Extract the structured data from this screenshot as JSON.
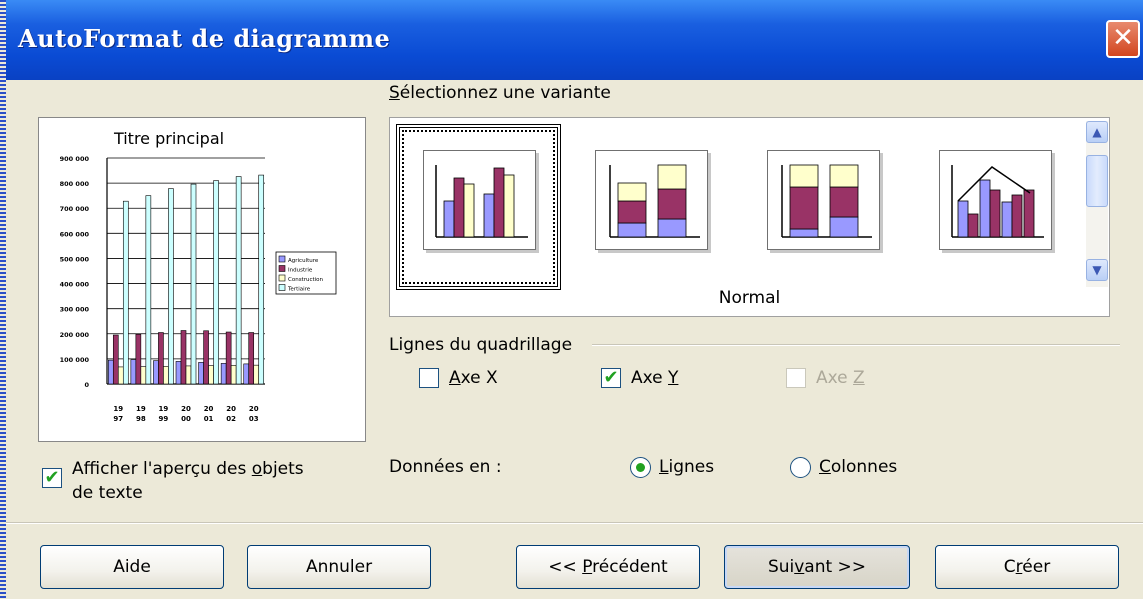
{
  "dialog": {
    "title": "AutoFormat de diagramme",
    "close_symbol": "✕"
  },
  "preview": {
    "chart_data": {
      "type": "bar",
      "title": "Titre principal",
      "categories": [
        "19 97",
        "19 98",
        "19 99",
        "20 00",
        "20 01",
        "20 02",
        "20 03"
      ],
      "y_ticks": [
        "900 000",
        "800 000",
        "700 000",
        "600 000",
        "500 000",
        "400 000",
        "300 000",
        "200 000",
        "100 000",
        "0"
      ],
      "ylim": [
        0,
        900000
      ],
      "series": [
        {
          "name": "Agriculture",
          "color": "#9999ff",
          "values": [
            95000,
            97000,
            93000,
            90000,
            86000,
            82000,
            80000
          ]
        },
        {
          "name": "Industrie",
          "color": "#993366",
          "values": [
            195000,
            198000,
            205000,
            213000,
            212000,
            207000,
            205000
          ]
        },
        {
          "name": "Construction",
          "color": "#ffffcc",
          "values": [
            68000,
            69000,
            70000,
            72000,
            73000,
            74000,
            75000
          ]
        },
        {
          "name": "Tertiaire",
          "color": "#ccffff",
          "values": [
            728000,
            750000,
            778000,
            796000,
            810000,
            826000,
            832000
          ]
        }
      ],
      "legend_position": "right",
      "grid": true
    }
  },
  "variants": {
    "label": "Sélectionnez une variante",
    "items": [
      "clustered-column-chart",
      "stacked-column-chart",
      "stacked-100-column-chart",
      "column-line-chart"
    ],
    "selected_name": "Normal",
    "selected_index": 0
  },
  "gridlines": {
    "label": "Lignes du quadrillage",
    "axe_x": {
      "label": "Axe X",
      "checked": false
    },
    "axe_y": {
      "label": "Axe Y",
      "checked": true
    },
    "axe_z": {
      "label": "Axe Z",
      "checked": false,
      "disabled": true
    }
  },
  "show_text": {
    "label_line1": "Afficher l'aperçu des objets",
    "label_line2": "de texte",
    "checked": true
  },
  "data_in": {
    "label": "Données en :",
    "options": [
      {
        "label": "Lignes",
        "selected": true
      },
      {
        "label": "Colonnes",
        "selected": false
      }
    ]
  },
  "buttons": {
    "help": "Aide",
    "cancel": "Annuler",
    "previous": "<< Précédent",
    "next": "Suivant >>",
    "create": "Créer"
  }
}
